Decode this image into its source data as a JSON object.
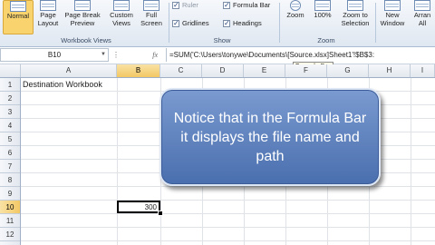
{
  "ribbon": {
    "workbook_views": {
      "buttons": [
        {
          "label": "Normal",
          "icon": "normal-view-icon"
        },
        {
          "label": "Page Layout",
          "icon": "page-layout-icon"
        },
        {
          "label": "Page Break Preview",
          "icon": "page-break-icon"
        },
        {
          "label": "Custom Views",
          "icon": "custom-views-icon"
        },
        {
          "label": "Full Screen",
          "icon": "full-screen-icon"
        }
      ],
      "group_label": "Workbook Views"
    },
    "show": {
      "checkboxes": [
        {
          "label": "Ruler",
          "checked": true,
          "enabled": false
        },
        {
          "label": "Formula Bar",
          "checked": true,
          "enabled": true
        },
        {
          "label": "Gridlines",
          "checked": true,
          "enabled": true
        },
        {
          "label": "Headings",
          "checked": true,
          "enabled": true
        }
      ],
      "group_label": "Show"
    },
    "zoom": {
      "buttons": [
        {
          "label": "Zoom",
          "icon": "zoom-icon"
        },
        {
          "label": "100%",
          "icon": "zoom-100-icon"
        },
        {
          "label": "Zoom to Selection",
          "icon": "zoom-selection-icon"
        }
      ],
      "group_label": "Zoom"
    },
    "window": {
      "buttons": [
        {
          "label": "New Window",
          "icon": "new-window-icon"
        },
        {
          "label": "Arran All",
          "icon": "arrange-all-icon"
        }
      ]
    }
  },
  "formula_bar": {
    "name_box": "B10",
    "fx": "fx",
    "formula": "=SUM('C:\\Users\\tonywe\\Documents\\[Source.xlsx]Sheet1'!$B$3:",
    "tooltip": "Formula Bar"
  },
  "grid": {
    "columns": [
      "A",
      "B",
      "C",
      "D",
      "E",
      "F",
      "G",
      "H",
      "I"
    ],
    "rows": [
      "1",
      "2",
      "3",
      "4",
      "5",
      "6",
      "7",
      "8",
      "9",
      "10",
      "11",
      "12"
    ],
    "active_column": "B",
    "active_row": "10",
    "a1_value": "Destination Workbook",
    "b10_value": "300"
  },
  "callout": {
    "text": "Notice that in the Formula Bar it displays the file name and path"
  },
  "colors": {
    "callout_fill": "#5a7dbb",
    "active_header": "#f3c864"
  }
}
